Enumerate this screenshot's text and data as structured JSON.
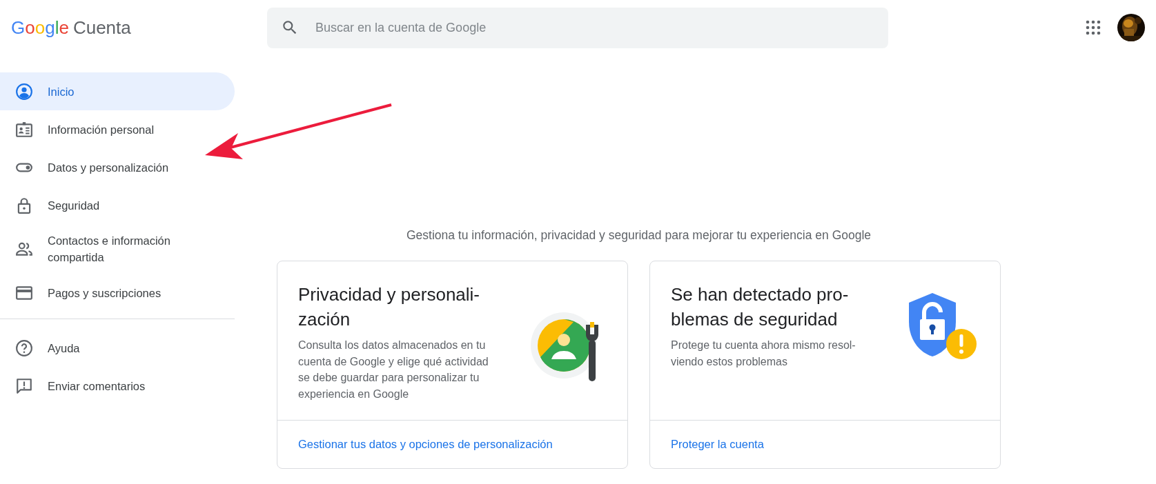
{
  "header": {
    "logo_brand": "Google",
    "product": "Cuenta"
  },
  "search": {
    "placeholder": "Buscar en la cuenta de Google"
  },
  "sidebar": {
    "items": [
      {
        "label": "Inicio",
        "selected": true
      },
      {
        "label": "Información personal",
        "selected": false
      },
      {
        "label": "Datos y personalización",
        "selected": false
      },
      {
        "label": "Seguridad",
        "selected": false
      },
      {
        "label": "Contactos e información compartida",
        "selected": false
      },
      {
        "label": "Pagos y suscripciones",
        "selected": false
      }
    ],
    "footer_items": [
      {
        "label": "Ayuda",
        "selected": false
      },
      {
        "label": "Enviar comentarios",
        "selected": false
      }
    ]
  },
  "intro": "Gestiona tu información, privacidad y seguridad para mejorar tu experiencia en Google",
  "cards": [
    {
      "kind": "privacy",
      "title": "Privacidad y personali-\nzación",
      "body": "Consulta los datos almacenados en tu\ncuenta de Google y elige qué actividad\nse debe guardar para personalizar tu\nexperiencia en Google",
      "link": "Gestionar tus datos y opciones de personalización"
    },
    {
      "kind": "security",
      "title": "Se han detectado pro-\nblemas de seguridad",
      "body": "Protege tu cuenta ahora mismo resol-\nviendo estos problemas",
      "link": "Proteger la cuenta"
    }
  ]
}
